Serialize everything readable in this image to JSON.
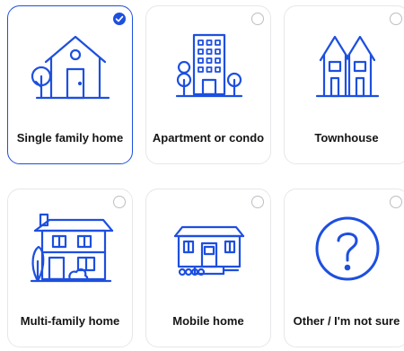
{
  "accent_color": "#1d4fe0",
  "options": [
    {
      "label": "Single family home",
      "icon": "single-family-house-icon",
      "selected": true
    },
    {
      "label": "Apartment or condo",
      "icon": "apartment-building-icon",
      "selected": false
    },
    {
      "label": "Townhouse",
      "icon": "townhouse-icon",
      "selected": false
    },
    {
      "label": "Multi-family home",
      "icon": "multi-family-house-icon",
      "selected": false
    },
    {
      "label": "Mobile home",
      "icon": "mobile-home-icon",
      "selected": false
    },
    {
      "label": "Other / I'm not sure",
      "icon": "question-mark-icon",
      "selected": false
    }
  ]
}
